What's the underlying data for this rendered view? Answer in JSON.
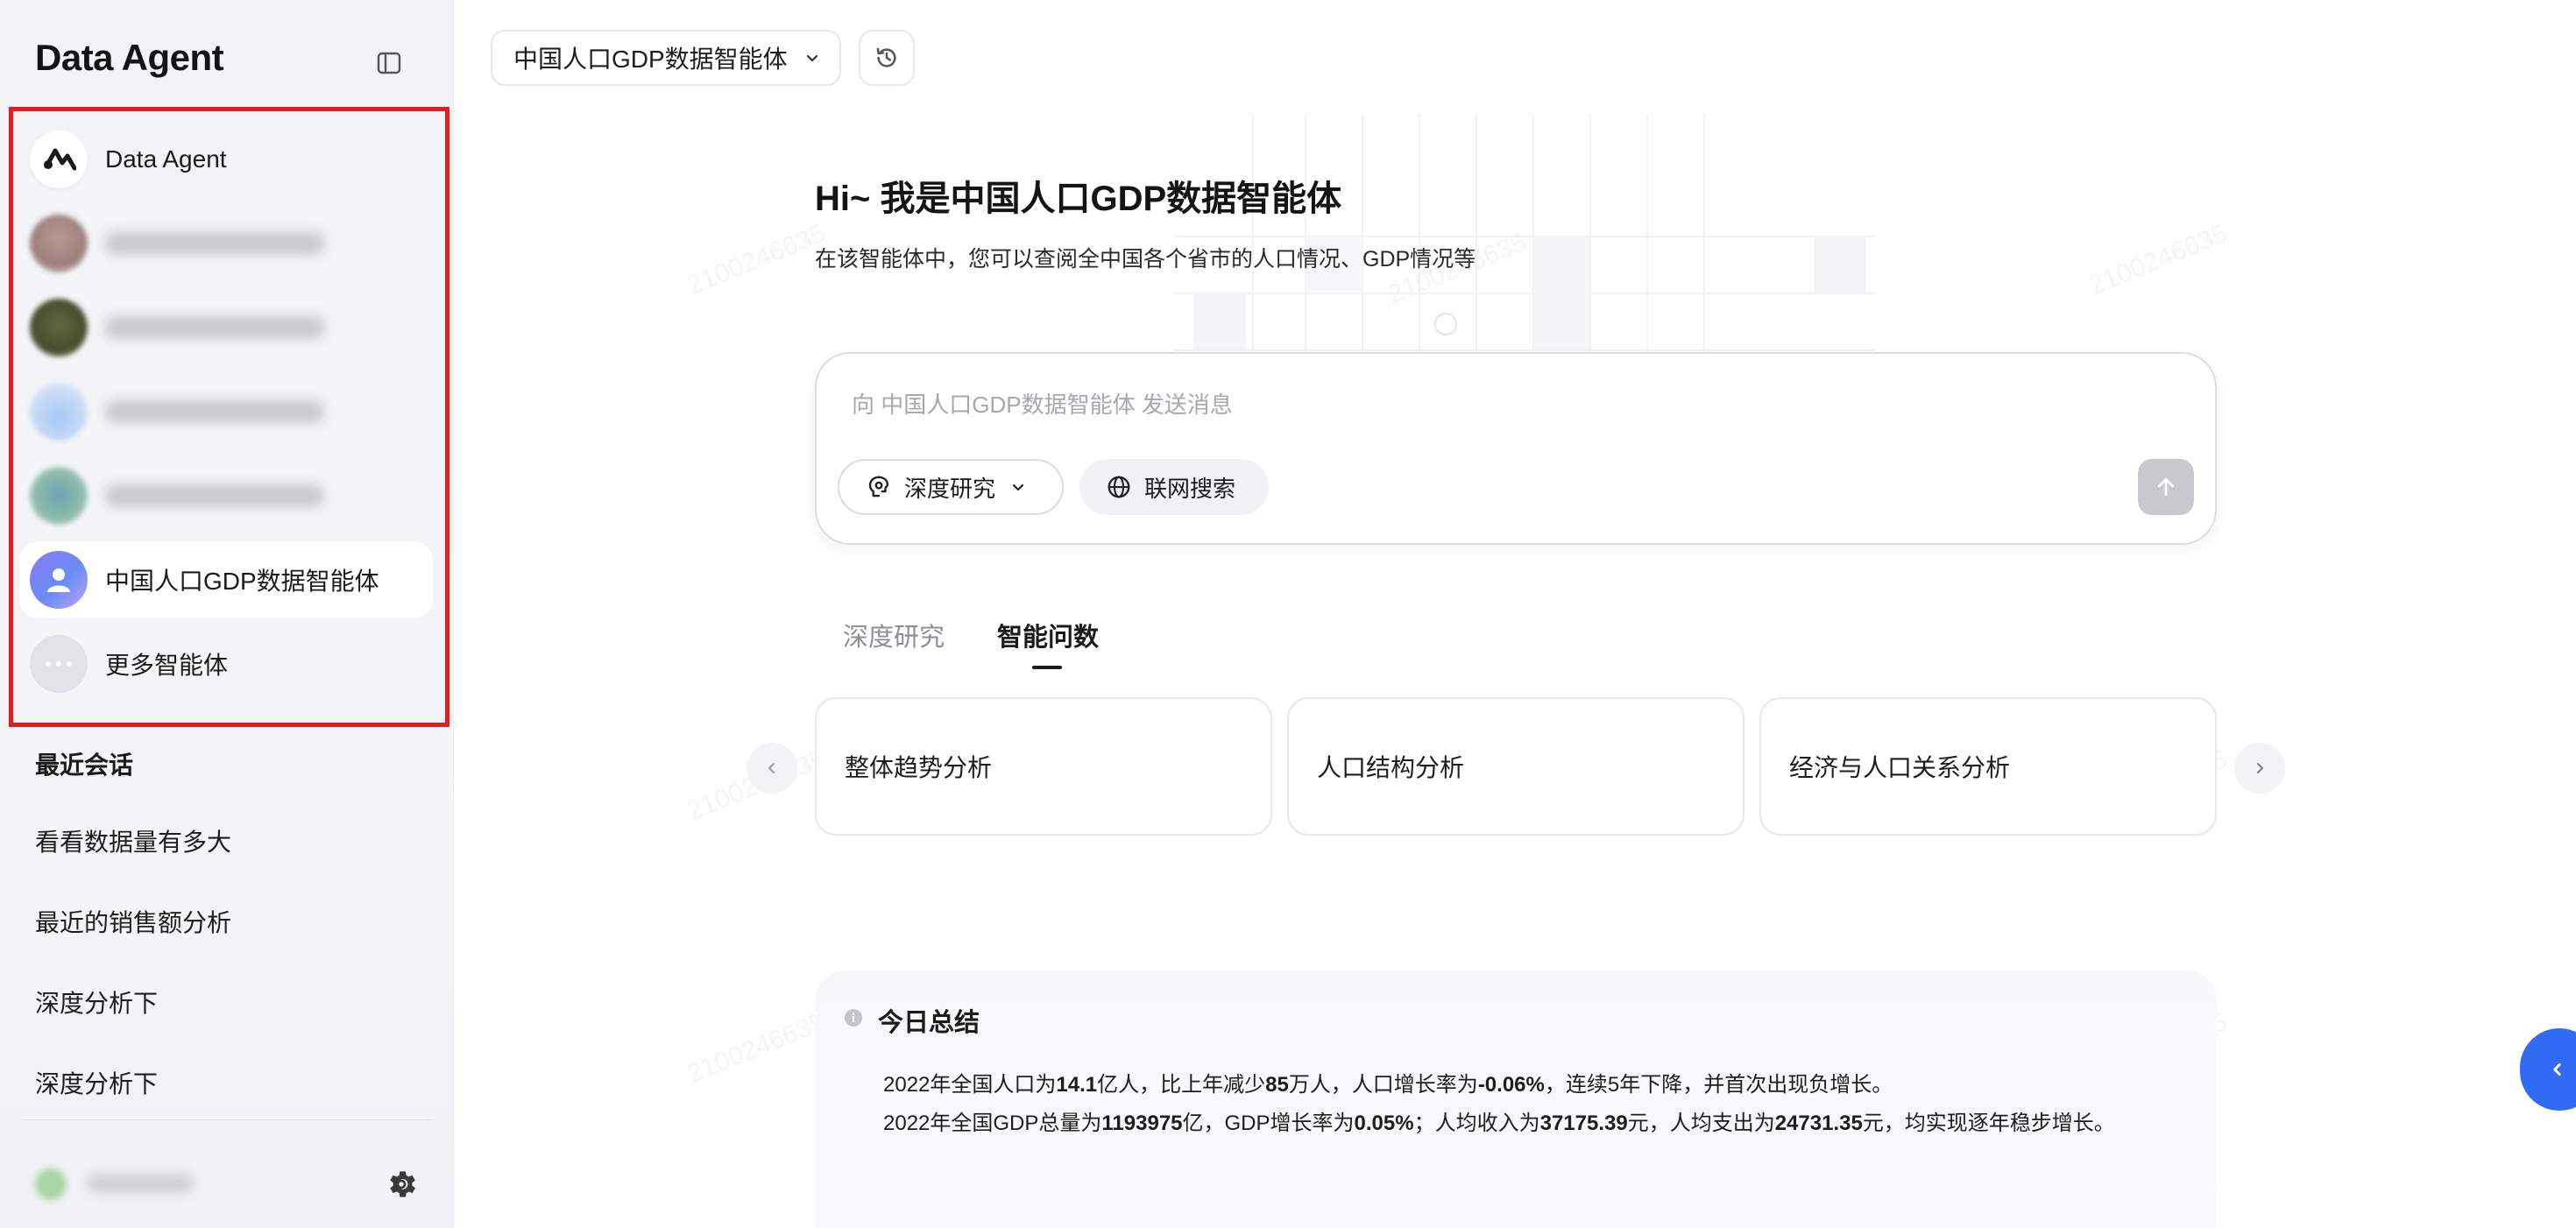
{
  "sidebar": {
    "brand": "Data Agent",
    "agents": [
      {
        "label": "Data Agent",
        "icon": "data-agent-logo-icon"
      },
      {
        "label": "",
        "icon": "avatar-blurred"
      },
      {
        "label": "",
        "icon": "avatar-blurred"
      },
      {
        "label": "",
        "icon": "avatar-blurred"
      },
      {
        "label": "",
        "icon": "avatar-blurred"
      },
      {
        "label": "中国人口GDP数据智能体",
        "icon": "person-avatar-icon",
        "active": true
      },
      {
        "label": "更多智能体",
        "icon": "more-dots-icon"
      }
    ],
    "recent_title": "最近会话",
    "recent": [
      "看看数据量有多大",
      "最近的销售额分析",
      "深度分析下",
      "深度分析下"
    ]
  },
  "topbar": {
    "agent_select": "中国人口GDP数据智能体"
  },
  "hero": {
    "title": "Hi~ 我是中国人口GDP数据智能体",
    "subtitle": "在该智能体中，您可以查阅全中国各个省市的人口情况、GDP情况等"
  },
  "chat": {
    "placeholder": "向 中国人口GDP数据智能体 发送消息",
    "mode_label": "深度研究",
    "search_label": "联网搜索"
  },
  "tabs": [
    {
      "label": "深度研究",
      "active": false
    },
    {
      "label": "智能问数",
      "active": true
    }
  ],
  "cards": [
    "整体趋势分析",
    "人口结构分析",
    "经济与人口关系分析"
  ],
  "summary": {
    "title": "今日总结",
    "line1": {
      "p1": "2022年全国人口为",
      "v1": "14.1",
      "p2": "亿人，比上年减少",
      "v2": "85",
      "p3": "万人，人口增长率为",
      "v3": "-0.06%",
      "p4": "，连续5年下降，并首次出现负增长。"
    },
    "line2": {
      "p1": "2022年全国GDP总量为",
      "v1": "1193975",
      "p2": "亿，GDP增长率为",
      "v2": "0.05%",
      "p3": "；人均收入为",
      "v3": "37175.39",
      "p4": "元，人均支出为",
      "v4": "24731.35",
      "p5": "元，均实现逐年稳步增长。"
    }
  },
  "watermark": "2100246635",
  "colors": {
    "accent": "#2f6cf3",
    "highlight_border": "#e02020",
    "send_disabled": "#c8c9cd"
  }
}
